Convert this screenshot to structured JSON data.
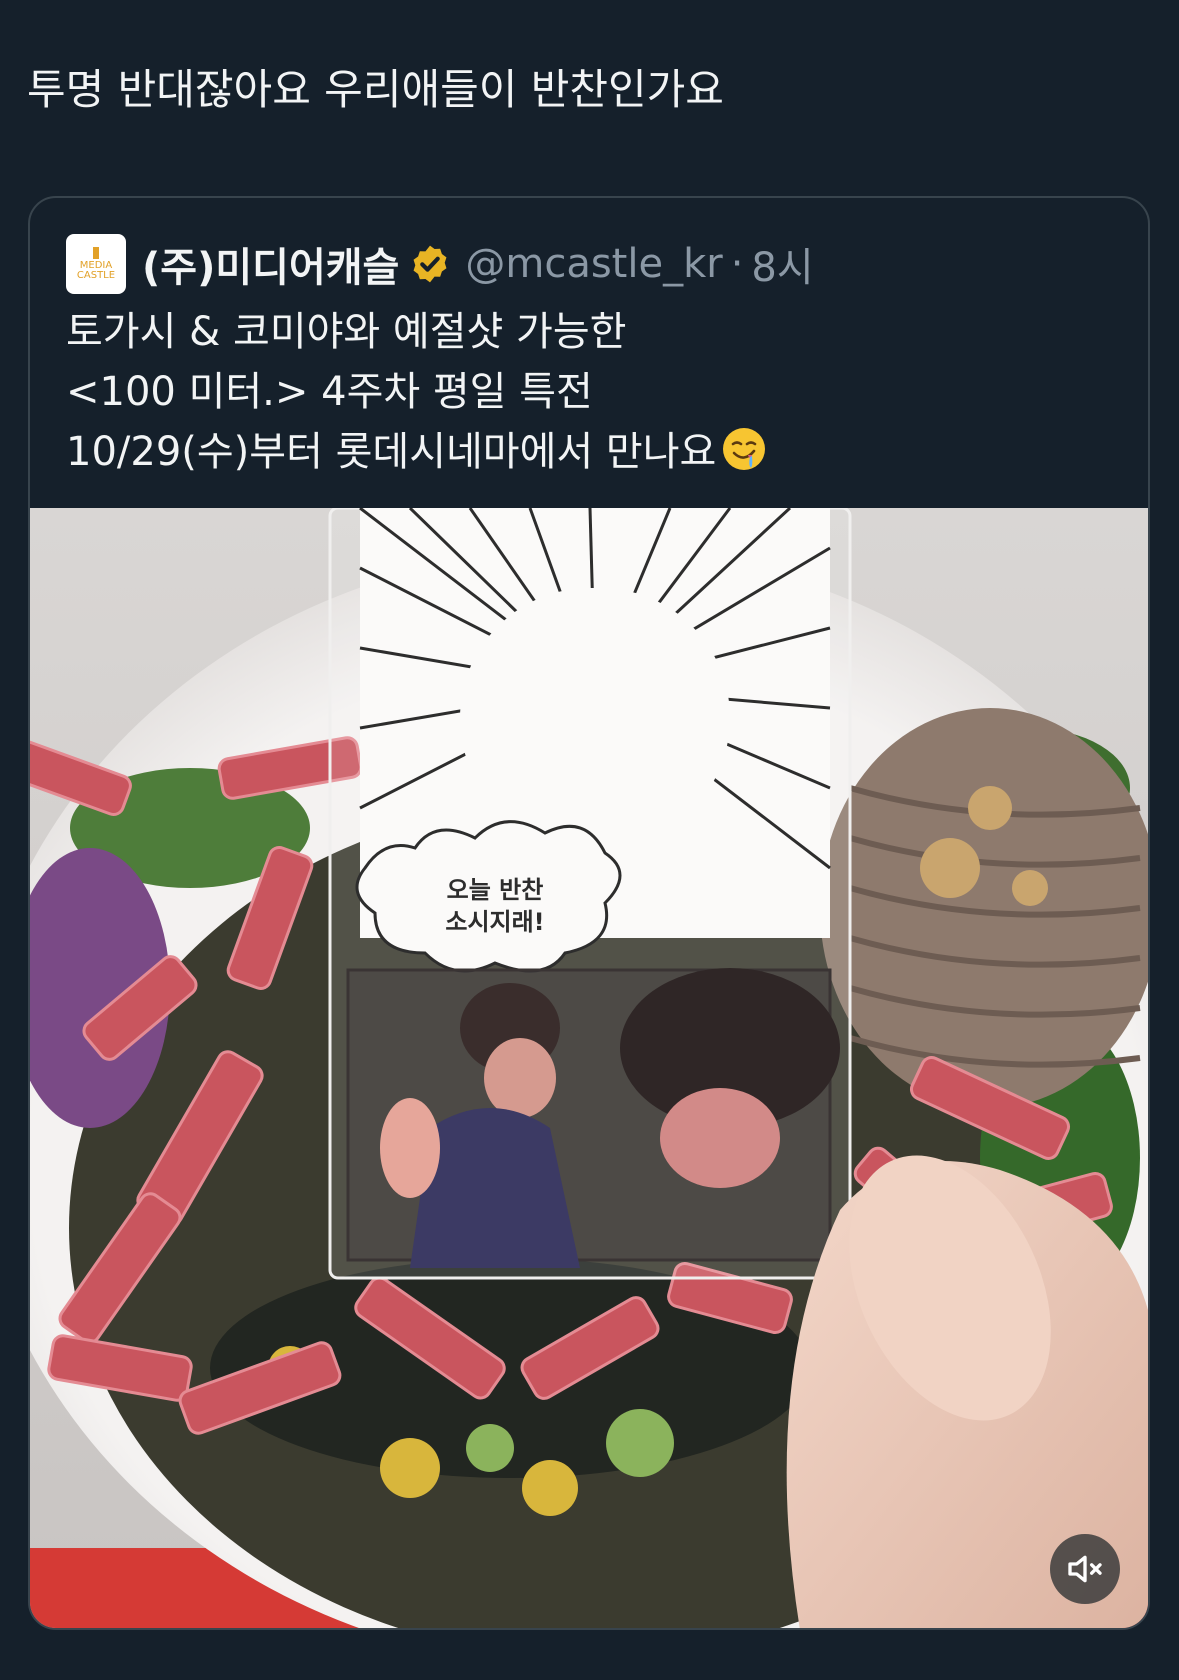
{
  "tweet": {
    "text": "투명 반대잖아요 우리애들이 반찬인가요"
  },
  "quote": {
    "avatar": {
      "line1": "MEDIA",
      "line2": "CASTLE"
    },
    "display_name": "(주)미디어캐슬",
    "handle": "@mcastle_kr",
    "separator": "·",
    "time": "8시",
    "body_lines": [
      "토가시 & 코미야와 예절샷 가능한",
      "<100 미터.> 4주차 평일 특전",
      "10/29(수)부터 롯데시네마에서 만나요"
    ],
    "emoji": "drooling-face",
    "media": {
      "speech_bubble": [
        "오늘 반찬",
        "소시지래!"
      ]
    }
  },
  "colors": {
    "background": "#15202b",
    "border": "#38444d",
    "text": "#f2f4f5",
    "secondary_text": "#8b98a5",
    "verified": "#e8b424",
    "brand": "#e2a128"
  },
  "icons": {
    "verified": "verified-badge-icon",
    "mute": "muted-speaker-icon"
  }
}
